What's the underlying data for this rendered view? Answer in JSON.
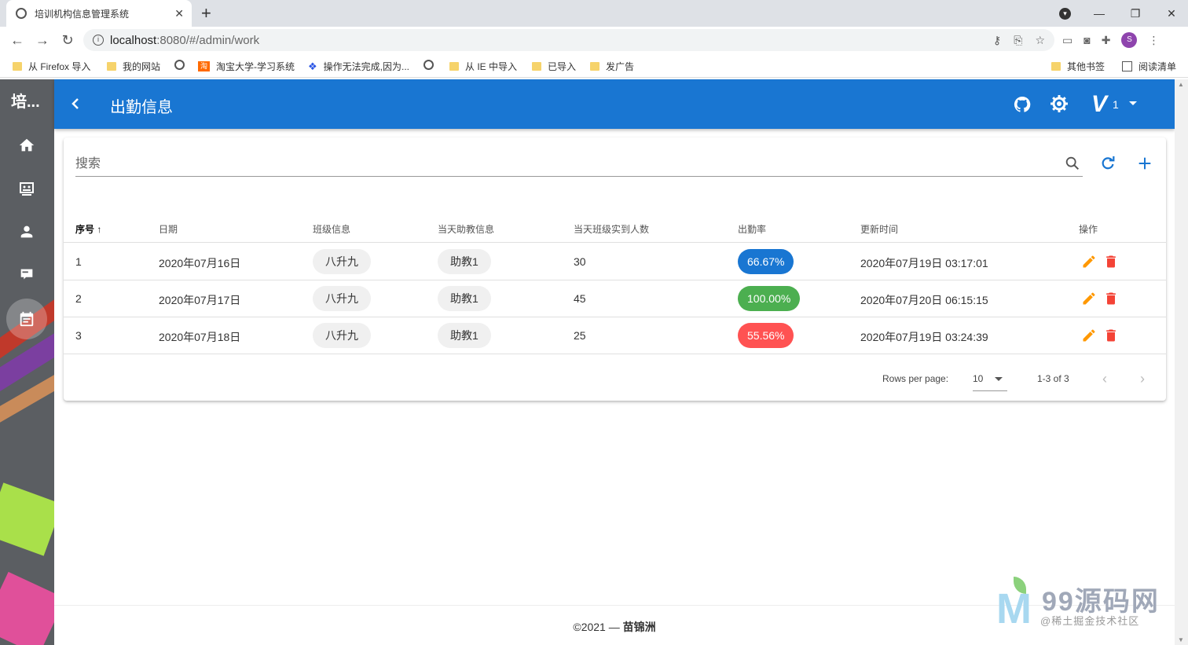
{
  "browser": {
    "tab_title": "培训机构信息管理系统",
    "url_host": "localhost",
    "url_path": ":8080/#/admin/work",
    "profile_initial": "S",
    "bookmarks": [
      "从 Firefox 导入",
      "我的网站",
      "淘宝大学-学习系统",
      "操作无法完成,因为...",
      "从 IE 中导入",
      "已导入",
      "发广告",
      "其他书签",
      "阅读清单"
    ],
    "taobao_badge": "淘"
  },
  "sidebar": {
    "brand": "培..."
  },
  "appbar": {
    "title": "出勤信息",
    "version_number": "1"
  },
  "search": {
    "placeholder": "搜索"
  },
  "table": {
    "headers": [
      "序号",
      "日期",
      "班级信息",
      "当天助教信息",
      "当天班级实到人数",
      "出勤率",
      "更新时间",
      "操作"
    ],
    "rows": [
      {
        "id": "1",
        "date": "2020年07月16日",
        "class": "八升九",
        "assistant": "助教1",
        "count": "30",
        "rate": "66.67%",
        "rate_color": "#1976d2",
        "updated": "2020年07月19日 03:17:01"
      },
      {
        "id": "2",
        "date": "2020年07月17日",
        "class": "八升九",
        "assistant": "助教1",
        "count": "45",
        "rate": "100.00%",
        "rate_color": "#4caf50",
        "updated": "2020年07月20日 06:15:15"
      },
      {
        "id": "3",
        "date": "2020年07月18日",
        "class": "八升九",
        "assistant": "助教1",
        "count": "25",
        "rate": "55.56%",
        "rate_color": "#ff5252",
        "updated": "2020年07月19日 03:24:39"
      }
    ]
  },
  "pagination": {
    "rows_per_page_label": "Rows per page:",
    "rows_per_page_value": "10",
    "range": "1-3 of 3"
  },
  "footer": {
    "copyright": "©2021 — ",
    "author": "苗锦洲"
  },
  "watermark": {
    "site": "99源码网",
    "sub": "@稀土掘金技术社区"
  },
  "colors": {
    "primary": "#1976d2",
    "edit": "#ff9800",
    "delete": "#f44336"
  }
}
